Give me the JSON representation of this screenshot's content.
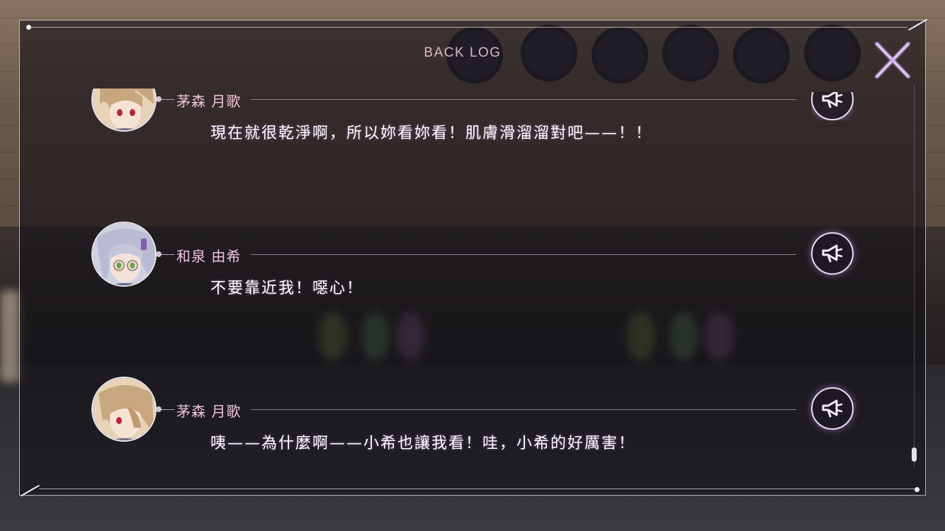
{
  "title": "BACK LOG",
  "entries": [
    {
      "speaker": "茅森 月歌",
      "text": "現在就很乾淨啊，所以妳看妳看！肌膚滑溜溜對吧——！！",
      "avatar": "blonde-hair-red-eyes",
      "voice_icon": "megaphone-icon"
    },
    {
      "speaker": "和泉 由希",
      "text": "不要靠近我！噁心！",
      "avatar": "silver-hair-green-eyes-glasses",
      "voice_icon": "megaphone-icon"
    },
    {
      "speaker": "茅森 月歌",
      "text": "咦——為什麼啊——小希也讓我看！哇，小希的好厲害！",
      "avatar": "blonde-hair-red-eyes",
      "voice_icon": "megaphone-icon"
    }
  ],
  "close_icon": "close-icon",
  "colors": {
    "accent_pink": "#f0c2da",
    "title": "#d9b9c9",
    "glow": "#b482e6"
  }
}
